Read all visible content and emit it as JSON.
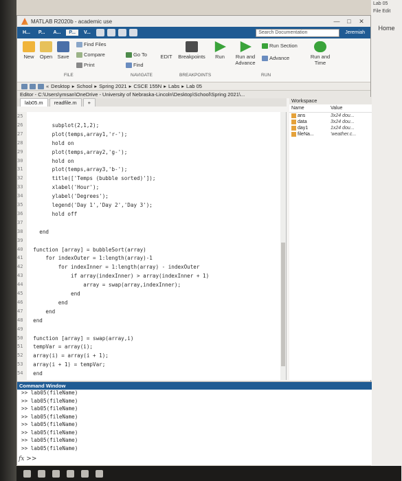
{
  "window": {
    "title": "MATLAB R2020b - academic use"
  },
  "ribbon_tabs": [
    "H...",
    "P...",
    "A...",
    "P...",
    "V..."
  ],
  "search": {
    "placeholder": "Search Documentation"
  },
  "user": "Jeremiah",
  "ribbon": {
    "new": "New",
    "open": "Open",
    "save": "Save",
    "find_files": "Find Files",
    "compare": "Compare",
    "print": "Print",
    "go_to": "Go To",
    "find": "Find",
    "edit": "EDIT",
    "breakpoints": "Breakpoints",
    "run": "Run",
    "run_advance": "Run and Advance",
    "run_section": "Run Section",
    "advance": "Advance",
    "run_time": "Run and Time",
    "sect_file": "FILE",
    "sect_navigate": "NAVIGATE",
    "sect_breakpoints": "BREAKPOINTS",
    "sect_run": "RUN"
  },
  "path": [
    "Desktop",
    "School",
    "Spring 2021",
    "CSCE 155N",
    "Labs",
    "Lab 05"
  ],
  "editor": {
    "title": "Editor - C:\\Users\\ymsan\\OneDrive - University of Nebraska-Lincoln\\Desktop\\School\\Spring 2021\\...",
    "tabs": [
      "lab05.m",
      "readfile.m"
    ],
    "lines": [
      {
        "n": "25",
        "t": ""
      },
      {
        "n": "26",
        "t": "        subplot(2,1,2);"
      },
      {
        "n": "27",
        "t": "        plot(temps,array1,'r-');"
      },
      {
        "n": "28",
        "t": "        hold on"
      },
      {
        "n": "29",
        "t": "        plot(temps,array2,'g-');"
      },
      {
        "n": "30",
        "t": "        hold on"
      },
      {
        "n": "31",
        "t": "        plot(temps,array3,'b-');"
      },
      {
        "n": "32",
        "t": "        title(['Temps (bubble sorted)']);"
      },
      {
        "n": "33",
        "t": "        xlabel('Hour');"
      },
      {
        "n": "34",
        "t": "        ylabel('Degrees');"
      },
      {
        "n": "35",
        "t": "        legend('Day 1','Day 2','Day 3');"
      },
      {
        "n": "36",
        "t": "        hold off"
      },
      {
        "n": "37",
        "t": ""
      },
      {
        "n": "38",
        "t": "    end"
      },
      {
        "n": "39",
        "t": ""
      },
      {
        "n": "40",
        "t": "  function [array] = bubbleSort(array)"
      },
      {
        "n": "41",
        "t": "      for indexOuter = 1:length(array)-1"
      },
      {
        "n": "42",
        "t": "          for indexInner = 1:length(array) - indexOuter"
      },
      {
        "n": "43",
        "t": "              if array(indexInner) > array(indexInner + 1)"
      },
      {
        "n": "44",
        "t": "                  array = swap(array,indexInner);"
      },
      {
        "n": "45",
        "t": "              end"
      },
      {
        "n": "46",
        "t": "          end"
      },
      {
        "n": "47",
        "t": "      end"
      },
      {
        "n": "48",
        "t": "  end"
      },
      {
        "n": "49",
        "t": ""
      },
      {
        "n": "50",
        "t": "  function [array] = swap(array,i)"
      },
      {
        "n": "51",
        "t": "  tempVar = array(i);"
      },
      {
        "n": "52",
        "t": "  array(i) = array(i + 1);"
      },
      {
        "n": "53",
        "t": "  array(i + 1) = tempVar;"
      },
      {
        "n": "54",
        "t": "  end"
      }
    ]
  },
  "workspace": {
    "title": "Workspace",
    "col_name": "Name",
    "col_value": "Value",
    "rows": [
      {
        "name": "ans",
        "value": "3x24 dou..."
      },
      {
        "name": "data",
        "value": "3x24 dou..."
      },
      {
        "name": "day1",
        "value": "1x24 dou..."
      },
      {
        "name": "fileNa...",
        "value": "'weather.c..."
      }
    ]
  },
  "command_window": {
    "title": "Command Window",
    "lines": [
      ">> lab05(fileName)",
      ">> lab05(fileName)",
      ">> lab05(fileName)",
      ">> lab05(fileName)",
      ">> lab05(fileName)",
      ">> lab05(fileName)",
      ">> lab05(fileName)",
      ">> lab05(fileName)"
    ],
    "prompt": ">>"
  },
  "right_panel": {
    "tab1": "Lab 05",
    "tab2": "File  Edit",
    "home": "Home"
  }
}
